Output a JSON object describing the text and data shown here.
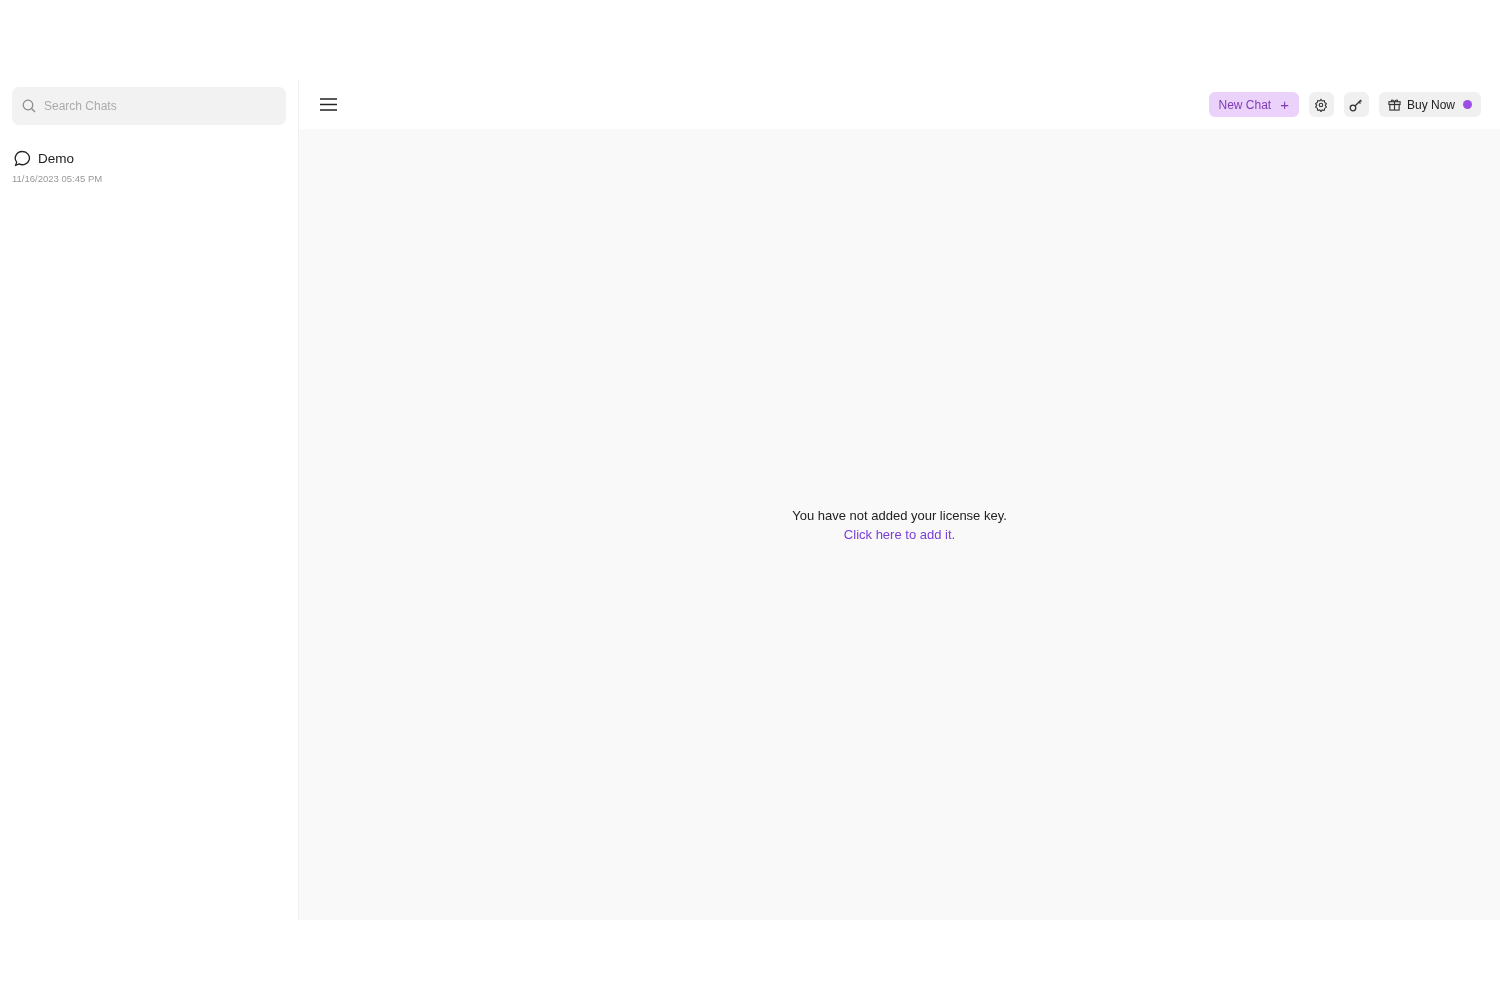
{
  "sidebar": {
    "search": {
      "placeholder": "Search Chats"
    },
    "chats": [
      {
        "title": "Demo",
        "time": "11/16/2023 05:45 PM"
      }
    ]
  },
  "header": {
    "new_chat": "New Chat",
    "plus": "+",
    "buy_now": "Buy Now"
  },
  "main": {
    "message": "You have not added your license key.",
    "link": "Click here to add it."
  }
}
